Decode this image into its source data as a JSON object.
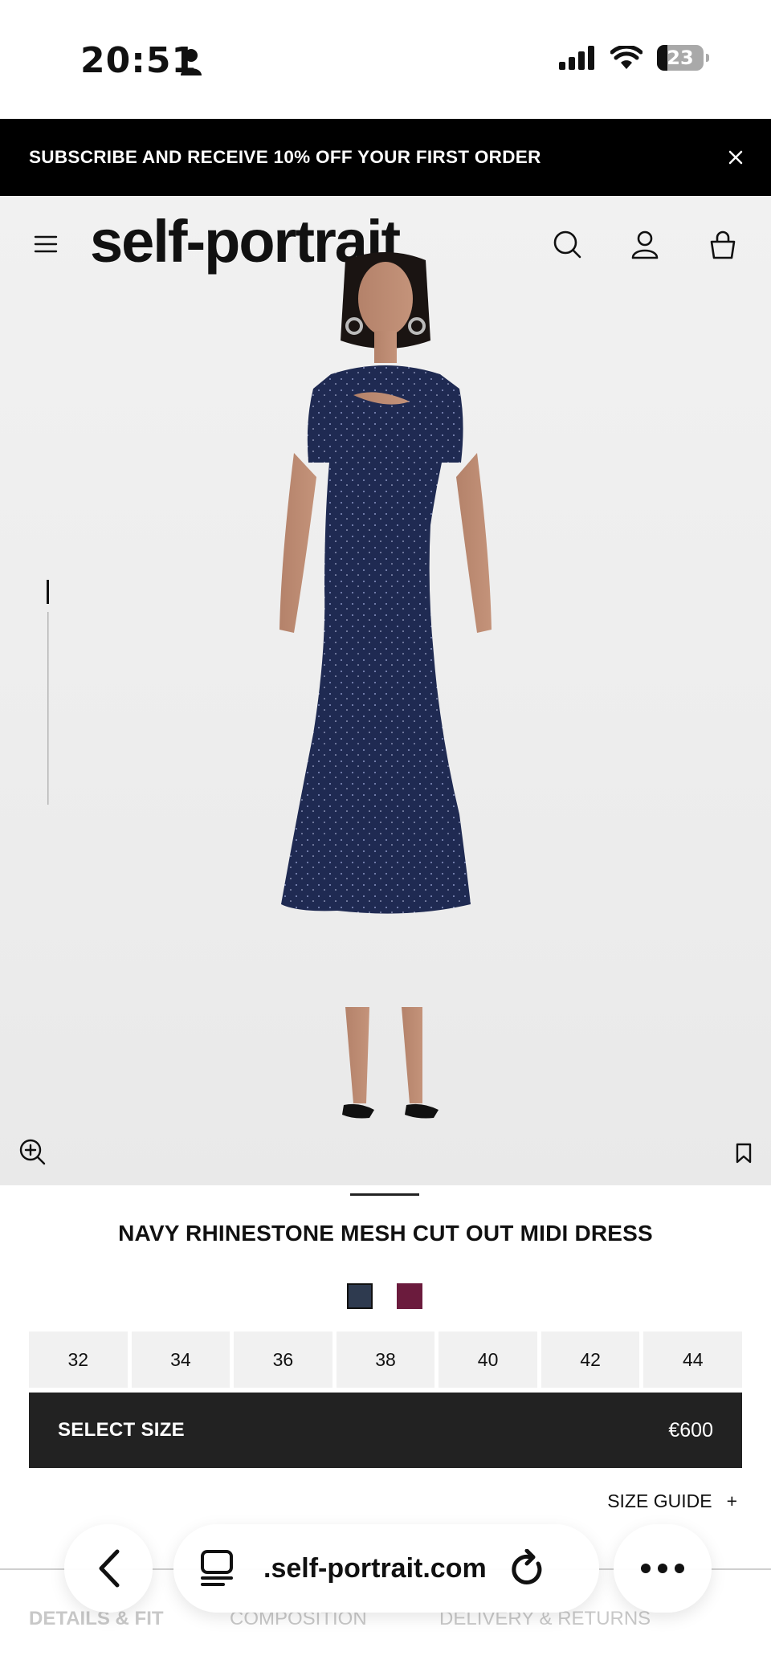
{
  "status_bar": {
    "time": "20:51",
    "battery": "23",
    "battery_level": 0.23
  },
  "promo": {
    "text": "SUBSCRIBE AND RECEIVE 10% OFF YOUR FIRST ORDER"
  },
  "header": {
    "logo": "self-portrait"
  },
  "product": {
    "title": "NAVY RHINESTONE MESH CUT OUT MIDI DRESS",
    "swatches": [
      {
        "color": "#2e3a4f",
        "selected": true
      },
      {
        "color": "#6b1b3d",
        "selected": false
      }
    ],
    "sizes": [
      "32",
      "34",
      "36",
      "38",
      "40",
      "42",
      "44"
    ],
    "select_label": "SELECT SIZE",
    "price": "€600",
    "size_guide": "SIZE GUIDE",
    "size_guide_symbol": "+"
  },
  "tabs": [
    "DETAILS & FIT",
    "COMPOSITION",
    "DELIVERY & RETURNS"
  ],
  "browser": {
    "url": ".self-portrait.com"
  },
  "colors": {
    "promo_bg": "#000000",
    "button_bg": "#222222",
    "dress": "#1f2a52"
  }
}
